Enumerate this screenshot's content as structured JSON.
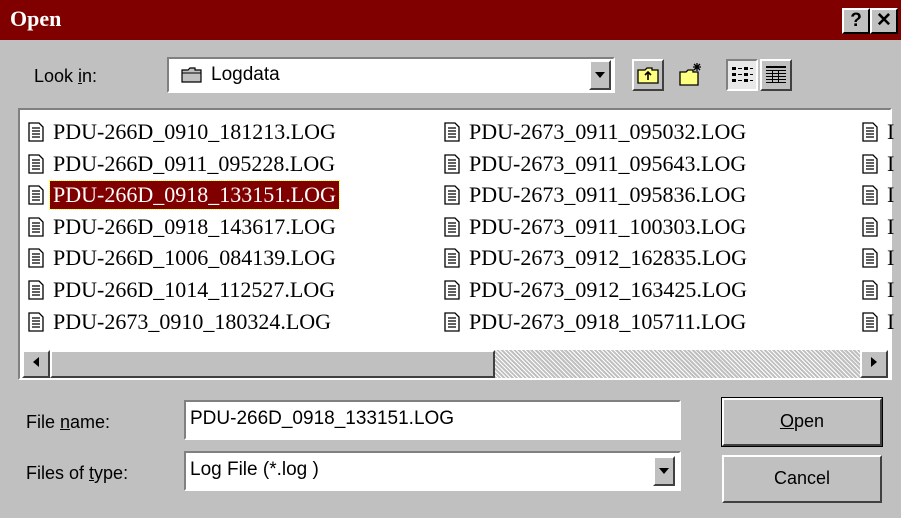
{
  "dialog": {
    "title": "Open",
    "help_glyph": "?",
    "close_glyph": "✕"
  },
  "lookin": {
    "label_pre": "Look ",
    "label_key": "i",
    "label_post": "n:",
    "value": "Logdata"
  },
  "toolbar": {
    "up_icon": "up-folder-icon",
    "new_folder_icon": "new-folder-icon",
    "list_icon": "list-view-icon",
    "details_icon": "details-view-icon"
  },
  "files": {
    "col1": [
      "PDU-266D_0910_181213.LOG",
      "PDU-266D_0911_095228.LOG",
      "PDU-266D_0918_133151.LOG",
      "PDU-266D_0918_143617.LOG",
      "PDU-266D_1006_084139.LOG",
      "PDU-266D_1014_112527.LOG",
      "PDU-2673_0910_180324.LOG"
    ],
    "col2": [
      "PDU-2673_0911_095032.LOG",
      "PDU-2673_0911_095643.LOG",
      "PDU-2673_0911_095836.LOG",
      "PDU-2673_0911_100303.LOG",
      "PDU-2673_0912_162835.LOG",
      "PDU-2673_0912_163425.LOG",
      "PDU-2673_0918_105711.LOG"
    ],
    "col3_partial": [
      "I",
      "I",
      "I",
      "I",
      "I",
      "I",
      "I"
    ],
    "selected": "PDU-266D_0918_133151.LOG"
  },
  "filename": {
    "label_pre": "File ",
    "label_key": "n",
    "label_post": "ame:",
    "value": "PDU-266D_0918_133151.LOG"
  },
  "filetype": {
    "label_pre": "Files of ",
    "label_key": "t",
    "label_post": "ype:",
    "value": "Log File (*.log )"
  },
  "buttons": {
    "open_key": "O",
    "open_rest": "pen",
    "cancel": "Cancel"
  },
  "colors": {
    "titlebar": "#800000",
    "selection": "#800000",
    "face": "#c0c0c0"
  }
}
